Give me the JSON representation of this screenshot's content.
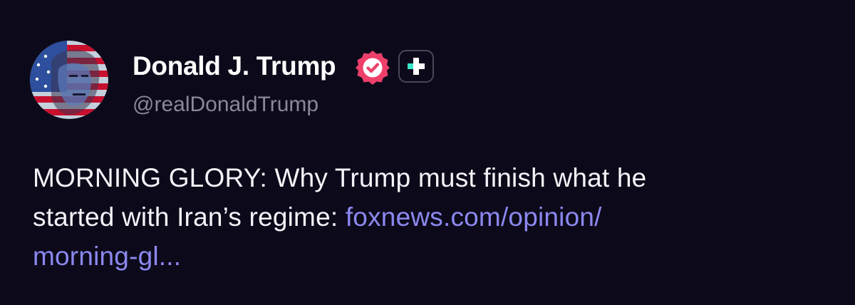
{
  "author": {
    "display_name": "Donald J. Trump",
    "handle": "@realDonaldTrump",
    "verified_icon": "verified-check-badge",
    "plus_icon": "plus-badge"
  },
  "post": {
    "text_line1": "MORNING GLORY: Why Trump must finish what he",
    "text_line2": "started with Iran’s regime: ",
    "link_part1": "foxnews.com/opinion/",
    "link_part2": "morning-gl..."
  },
  "colors": {
    "background": "#0c0a1a",
    "text": "#f4f3f8",
    "handle": "#8b8899",
    "link": "#8c88f0",
    "verified_badge": "#ee3f6b",
    "plus_accent": "#38e6c6"
  }
}
